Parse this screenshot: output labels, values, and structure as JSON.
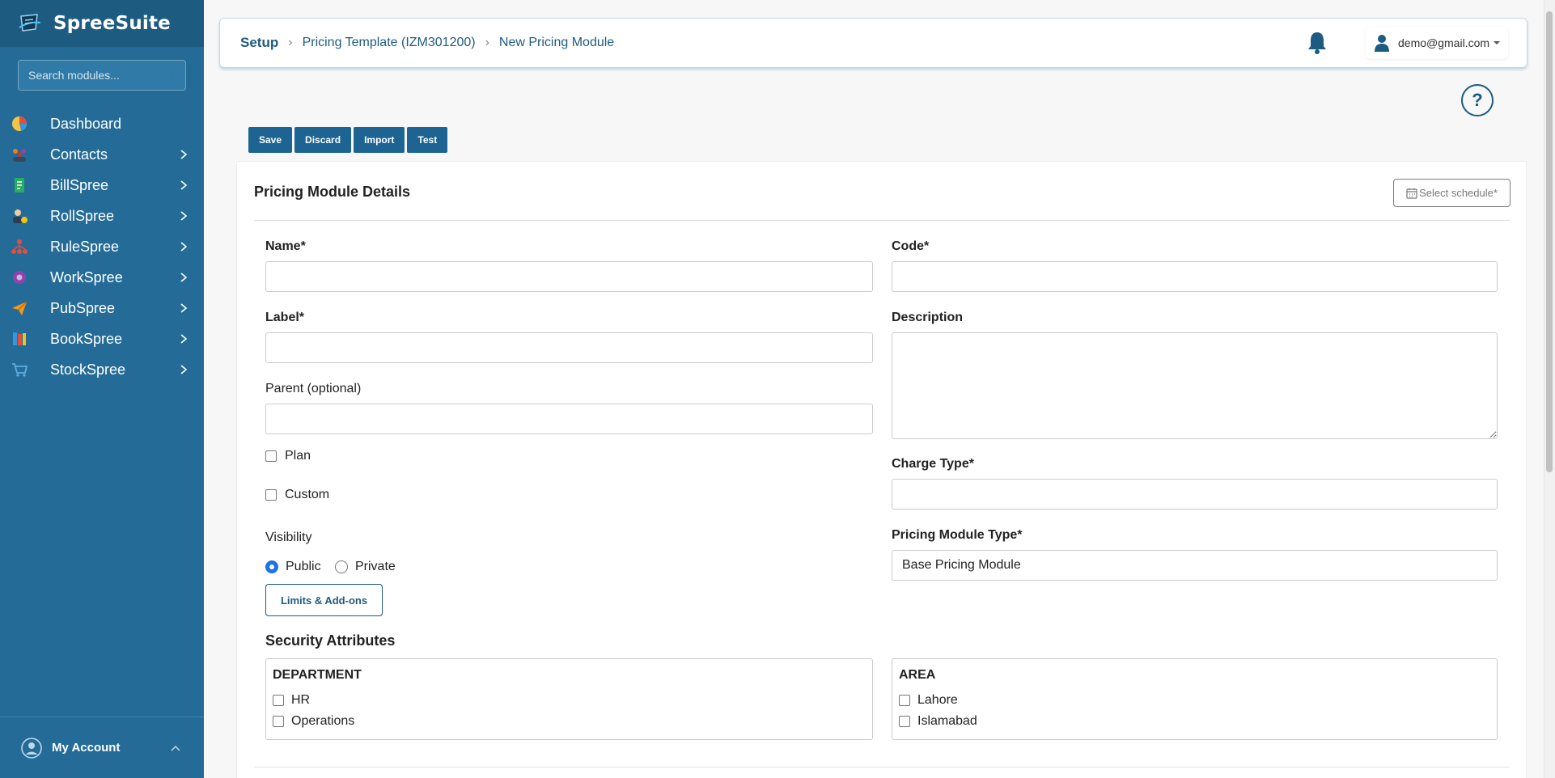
{
  "sidebar": {
    "brand": "SpreeSuite",
    "search_placeholder": "Search modules...",
    "items": [
      {
        "label": "Dashboard",
        "icon": "pie-chart-icon",
        "has_children": false
      },
      {
        "label": "Contacts",
        "icon": "people-group-icon",
        "has_children": true
      },
      {
        "label": "BillSpree",
        "icon": "bill-document-icon",
        "has_children": true
      },
      {
        "label": "RollSpree",
        "icon": "payroll-person-icon",
        "has_children": true
      },
      {
        "label": "RuleSpree",
        "icon": "rules-network-icon",
        "has_children": true
      },
      {
        "label": "WorkSpree",
        "icon": "workflow-gear-icon",
        "has_children": true
      },
      {
        "label": "PubSpree",
        "icon": "paper-plane-icon",
        "has_children": true
      },
      {
        "label": "BookSpree",
        "icon": "books-icon",
        "has_children": true
      },
      {
        "label": "StockSpree",
        "icon": "shopping-cart-icon",
        "has_children": true
      }
    ],
    "account_label": "My Account"
  },
  "header": {
    "breadcrumb": [
      "Setup",
      "Pricing Template (IZM301200)",
      "New Pricing Module"
    ],
    "user_email": "demo@gmail.com"
  },
  "toolbar": {
    "save": "Save",
    "discard": "Discard",
    "import": "Import",
    "test": "Test"
  },
  "form": {
    "title": "Pricing Module Details",
    "schedule_button": "Select schedule*",
    "name_label": "Name*",
    "name_value": "",
    "code_label": "Code*",
    "code_value": "",
    "label_label": "Label*",
    "label_value": "",
    "description_label": "Description",
    "description_value": "",
    "parent_label": "Parent (optional)",
    "parent_value": "",
    "plan_label": "Plan",
    "custom_label": "Custom",
    "charge_type_label": "Charge Type*",
    "charge_type_value": "",
    "visibility_label": "Visibility",
    "visibility_options": [
      "Public",
      "Private"
    ],
    "visibility_selected": "Public",
    "pricing_module_type_label": "Pricing Module Type*",
    "pricing_module_type_value": "Base Pricing Module",
    "limits_button": "Limits & Add-ons"
  },
  "security": {
    "title": "Security Attributes",
    "department": {
      "title": "DEPARTMENT",
      "options": [
        "HR",
        "Operations"
      ]
    },
    "area": {
      "title": "AREA",
      "options": [
        "Lahore",
        "Islamabad"
      ]
    }
  },
  "colors": {
    "sidebar_bg": "#246c97",
    "brand_bg": "#1d5b80",
    "primary_button": "#1d6493",
    "radio_accent": "#1a73e8"
  }
}
